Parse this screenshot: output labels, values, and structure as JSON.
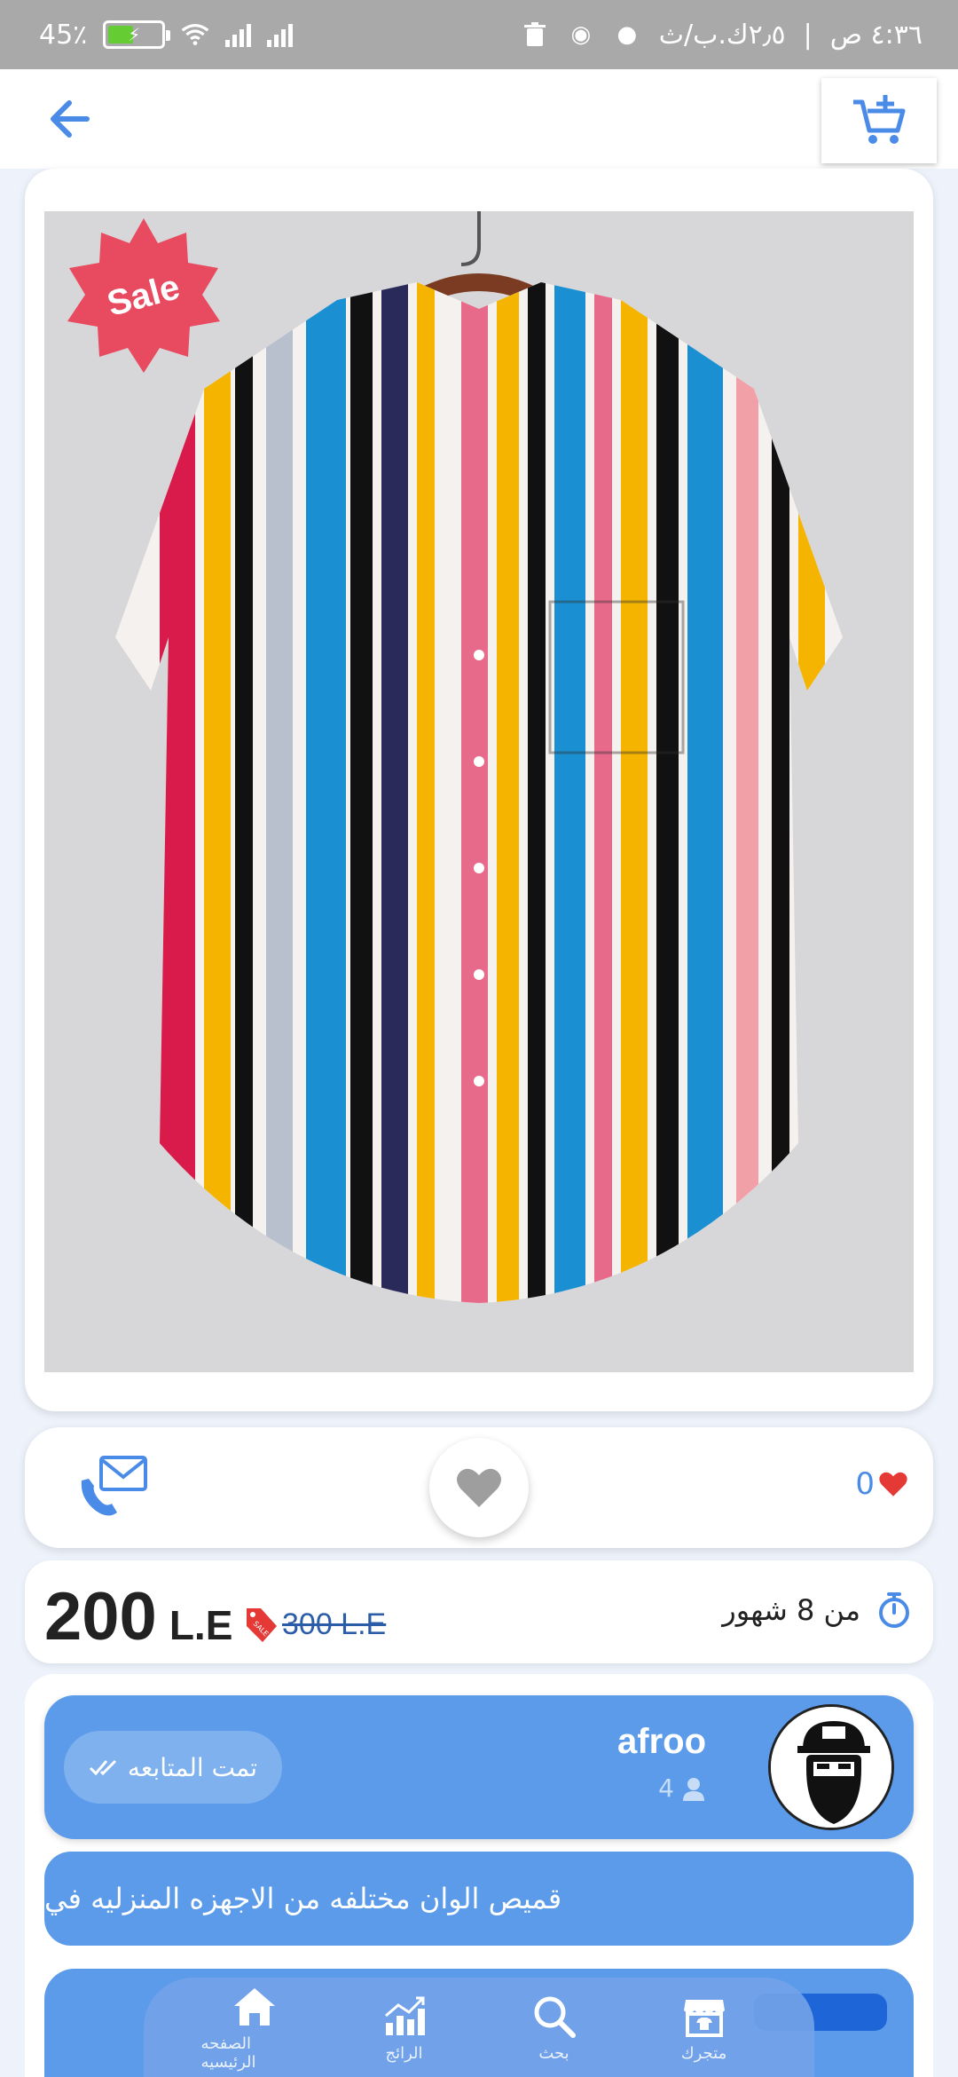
{
  "status_bar": {
    "battery_percent": "45٪",
    "time": "٤:٣٦ ص",
    "network_speed": "٢٫٥ك.ب/ث"
  },
  "product": {
    "sale_badge": "Sale",
    "likes": "0",
    "time_posted": "من 8 شهور",
    "price": "200",
    "currency": "L.E",
    "old_price": "300 L.E",
    "tag_label": "SALE"
  },
  "seller": {
    "name": "afroo",
    "followers": "4",
    "follow_state": "تمت المتابعه",
    "description": "قميص الوان مختلفه من الاجهزه المنزليه في"
  },
  "nav": {
    "home": "الصفحه الرئيسيه",
    "trending": "الرائج",
    "search": "بحث",
    "store": "متجرك"
  },
  "colors": {
    "accent": "#5b9bea",
    "heart": "#e53935",
    "sale": "#e84a5f"
  }
}
